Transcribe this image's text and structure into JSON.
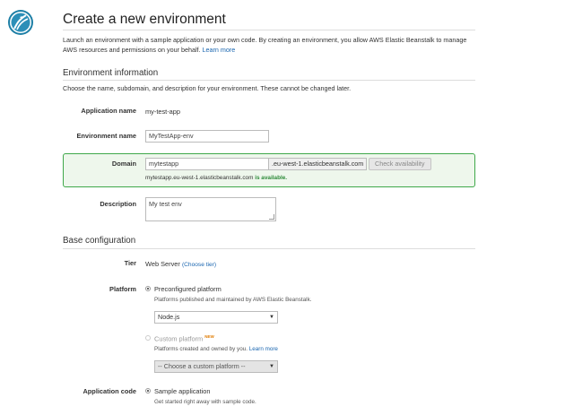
{
  "header": {
    "title": "Create a new environment",
    "intro": "Launch an environment with a sample application or your own code. By creating an environment, you allow AWS Elastic Beanstalk to manage AWS resources and permissions on your behalf.",
    "learn_more": "Learn more"
  },
  "env_info": {
    "heading": "Environment information",
    "description": "Choose the name, subdomain, and description for your environment. These cannot be changed later.",
    "app_name_label": "Application name",
    "app_name_value": "my-test-app",
    "env_name_label": "Environment name",
    "env_name_value": "MyTestApp-env",
    "domain_label": "Domain",
    "domain_value": "mytestapp",
    "domain_suffix": ".eu-west-1.elasticbeanstalk.com",
    "check_button": "Check availability",
    "availability_host": "mytestapp.eu-west-1.elasticbeanstalk.com",
    "availability_status": "is available.",
    "description_label": "Description",
    "description_value": "My test env"
  },
  "base_config": {
    "heading": "Base configuration",
    "tier_label": "Tier",
    "tier_value": "Web Server",
    "choose_tier": "(Choose tier)",
    "platform_label": "Platform",
    "preconfigured_label": "Preconfigured platform",
    "preconfigured_note": "Platforms published and maintained by AWS Elastic Beanstalk.",
    "platform_selected": "Node.js",
    "custom_label": "Custom platform",
    "custom_badge": "NEW",
    "custom_note": "Platforms created and owned by you.",
    "custom_learn_more": "Learn more",
    "custom_select": "-- Choose a custom platform --",
    "app_code_label": "Application code",
    "sample_label": "Sample application",
    "sample_note": "Get started right away with sample code."
  },
  "colors": {
    "link": "#1a66b0",
    "available": "#2e8b3a",
    "domain_border": "#3fa84a"
  }
}
